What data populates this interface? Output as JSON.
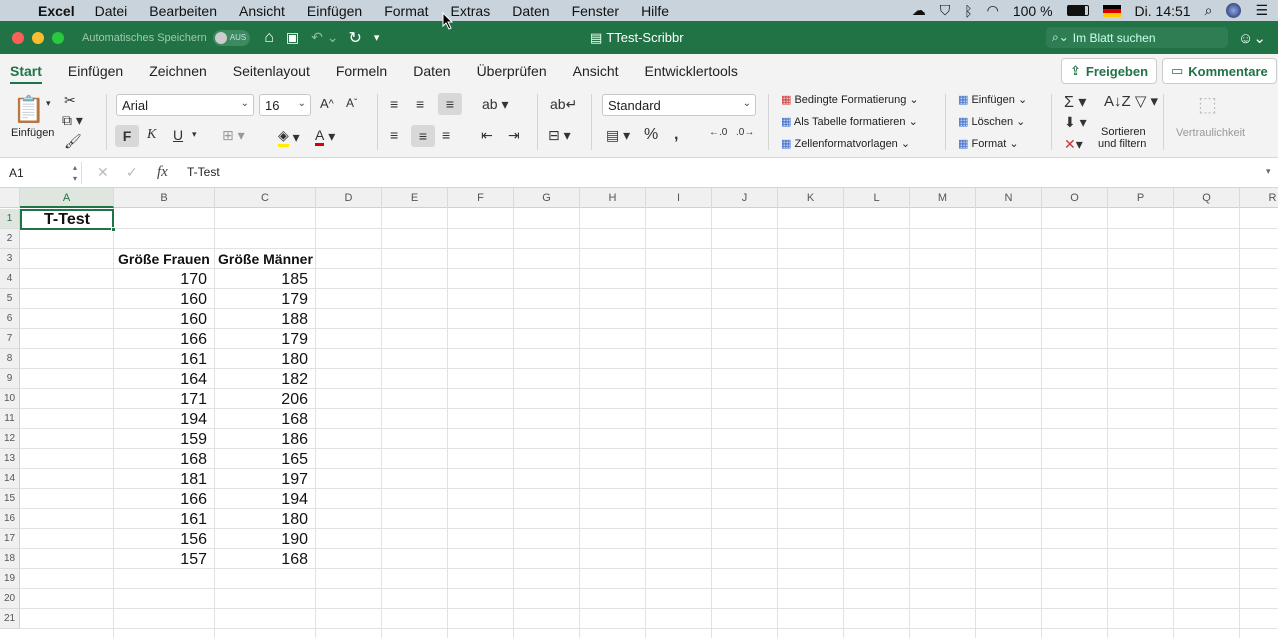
{
  "menubar": {
    "app": "Excel",
    "items": [
      "Datei",
      "Bearbeiten",
      "Ansicht",
      "Einfügen",
      "Format",
      "Extras",
      "Daten",
      "Fenster",
      "Hilfe"
    ],
    "battery": "100 %",
    "clock": "Di. 14:51"
  },
  "titlebar": {
    "autosave": "Automatisches Speichern",
    "autosave_state": "AUS",
    "title": "TTest-Scribbr",
    "search_placeholder": "Im Blatt suchen"
  },
  "tabs": [
    "Start",
    "Einfügen",
    "Zeichnen",
    "Seitenlayout",
    "Formeln",
    "Daten",
    "Überprüfen",
    "Ansicht",
    "Entwicklertools"
  ],
  "share_label": "Freigeben",
  "comments_label": "Kommentare",
  "ribbon": {
    "paste_label": "Einfügen",
    "font_name": "Arial",
    "font_size": "16",
    "bold": "F",
    "italic": "K",
    "underline": "U",
    "number_format": "Standard",
    "cond_format": "Bedingte Formatierung",
    "as_table": "Als Tabelle formatieren",
    "cell_styles": "Zellenformatvorlagen",
    "insert": "Einfügen",
    "delete": "Löschen",
    "format": "Format",
    "sort_filter_1": "Sortieren",
    "sort_filter_2": "und filtern",
    "sensitivity": "Vertraulichkeit"
  },
  "formula_bar": {
    "name_box": "A1",
    "fx": "fx",
    "content": "T-Test"
  },
  "columns": [
    "A",
    "B",
    "C",
    "D",
    "E",
    "F",
    "G",
    "H",
    "I",
    "J",
    "K",
    "L",
    "M",
    "N",
    "O",
    "P",
    "Q",
    "R"
  ],
  "rows": [
    "1",
    "2",
    "3",
    "4",
    "5",
    "6",
    "7",
    "8",
    "9",
    "10",
    "11",
    "12",
    "13",
    "14",
    "15",
    "16",
    "17",
    "18",
    "19",
    "20",
    "21"
  ],
  "sheet": {
    "a1": "T-Test",
    "header_b": "Größe Frauen",
    "header_c": "Größe Männer",
    "women": [
      "170",
      "160",
      "160",
      "166",
      "161",
      "164",
      "171",
      "194",
      "159",
      "168",
      "181",
      "166",
      "161",
      "156",
      "157"
    ],
    "men": [
      "185",
      "179",
      "188",
      "179",
      "180",
      "182",
      "206",
      "168",
      "186",
      "165",
      "197",
      "194",
      "180",
      "190",
      "168"
    ]
  }
}
